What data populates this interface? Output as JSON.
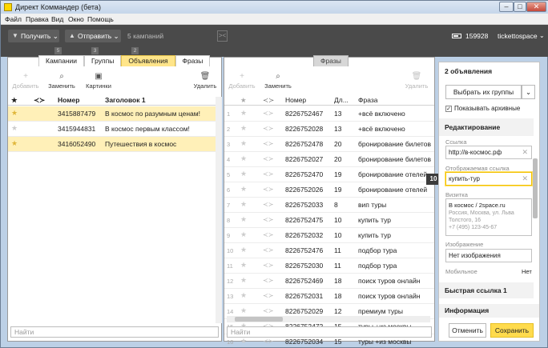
{
  "window": {
    "title": "Директ Коммандер (бета)",
    "minimize": "–",
    "maximize": "□",
    "close": "✕"
  },
  "menu": [
    "Файл",
    "Правка",
    "Вид",
    "Окно",
    "Помощь"
  ],
  "toolbar": {
    "get_label": "Получить",
    "send_label": "Отправить",
    "campaign_count": "5 кампаний",
    "balance": "159928",
    "account": "tickettospace"
  },
  "tabs": [
    {
      "label": "Кампании",
      "count": "5"
    },
    {
      "label": "Группы",
      "count": "3"
    },
    {
      "label": "Объявления",
      "count": "2"
    },
    {
      "label": "Фразы",
      "count": ""
    }
  ],
  "left_panel": {
    "actions": {
      "add": "Добавить",
      "replace": "Заменить",
      "images": "Картинки",
      "delete": "Удалить"
    },
    "columns": {
      "star": "★",
      "status": "≺≻",
      "number": "Номер",
      "title": "Заголовок 1"
    },
    "rows": [
      {
        "number": "3415887479",
        "title": "В космос по разумным ценам!",
        "highlight": true
      },
      {
        "number": "3415944831",
        "title": "В космос первым классом!",
        "highlight": false
      },
      {
        "number": "3416052490",
        "title": "Путешествия в космос",
        "highlight": true
      }
    ],
    "search_placeholder": "Найти"
  },
  "middle_panel": {
    "tab_label": "Фразы",
    "actions": {
      "add": "Добавить",
      "replace": "Заменить",
      "delete": "Удалить"
    },
    "columns": {
      "number": "Номер",
      "length": "Дл...",
      "phrase": "Фраза"
    },
    "rows": [
      {
        "i": "1",
        "number": "8226752467",
        "len": "13",
        "phrase": "+всё включено"
      },
      {
        "i": "2",
        "number": "8226752028",
        "len": "13",
        "phrase": "+всё включено"
      },
      {
        "i": "3",
        "number": "8226752478",
        "len": "20",
        "phrase": "бронирование билетов"
      },
      {
        "i": "4",
        "number": "8226752027",
        "len": "20",
        "phrase": "бронирование билетов"
      },
      {
        "i": "5",
        "number": "8226752470",
        "len": "19",
        "phrase": "бронирование отелей"
      },
      {
        "i": "6",
        "number": "8226752026",
        "len": "19",
        "phrase": "бронирование отелей"
      },
      {
        "i": "7",
        "number": "8226752033",
        "len": "8",
        "phrase": "вип туры"
      },
      {
        "i": "8",
        "number": "8226752475",
        "len": "10",
        "phrase": "купить тур"
      },
      {
        "i": "9",
        "number": "8226752032",
        "len": "10",
        "phrase": "купить тур"
      },
      {
        "i": "10",
        "number": "8226752476",
        "len": "11",
        "phrase": "подбор тура"
      },
      {
        "i": "11",
        "number": "8226752030",
        "len": "11",
        "phrase": "подбор тура"
      },
      {
        "i": "12",
        "number": "8226752469",
        "len": "18",
        "phrase": "поиск туров онлайн"
      },
      {
        "i": "13",
        "number": "8226752031",
        "len": "18",
        "phrase": "поиск туров онлайн"
      },
      {
        "i": "14",
        "number": "8226752029",
        "len": "12",
        "phrase": "премиум туры"
      },
      {
        "i": "15",
        "number": "8226752472",
        "len": "15",
        "phrase": "туры +из москвы"
      },
      {
        "i": "16",
        "number": "8226752034",
        "len": "15",
        "phrase": "туры +из москвы"
      }
    ],
    "search_placeholder": "Найти"
  },
  "right_panel": {
    "count_title": "2 объявления",
    "choose_group": "Выбрать их группы",
    "show_archived": "Показывать архивные",
    "editing_title": "Редактирование",
    "link_label": "Ссылка",
    "link_value": "http://в-космос.рф",
    "display_link_label": "Отображаемая ссылка",
    "display_link_value": "купить-тур",
    "display_link_limit": "10",
    "vcard_label": "Визитка",
    "vcard_line1": "В космос / 2space.ru",
    "vcard_line2": "Россия, Москва, ул. Льва Толстого, 16",
    "vcard_line3": "+7 (495) 123-45-67",
    "image_label": "Изображение",
    "image_value": "Нет изображения",
    "mobile_label": "Мобильное",
    "mobile_value": "Нет",
    "quicklink_title": "Быстрая ссылка 1",
    "info_title": "Информация",
    "cancel": "Отменить",
    "save": "Сохранить"
  },
  "colors": {
    "accent": "#ffdb4d",
    "highlight_row": "#fff0b8",
    "toolbar": "#4a4a4a"
  }
}
